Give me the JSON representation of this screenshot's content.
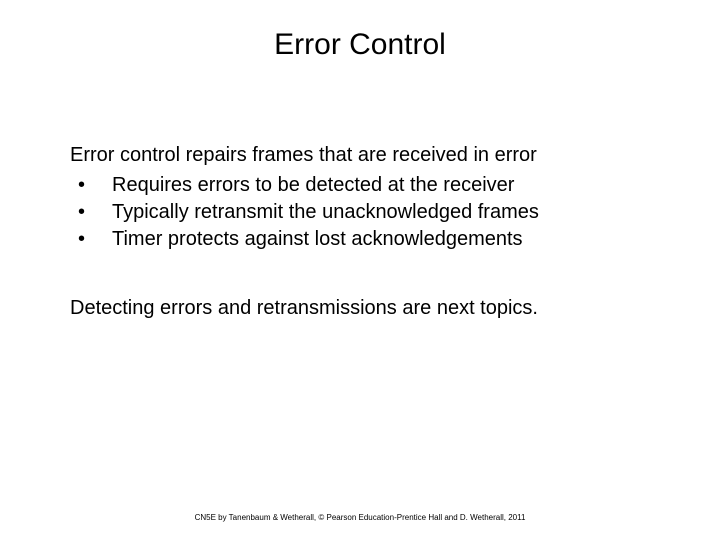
{
  "slide": {
    "title": "Error Control",
    "intro": "Error control repairs frames that are received in error",
    "bullets": [
      "Requires errors to be detected at the receiver",
      "Typically retransmit the unacknowledged frames",
      "Timer protects against lost acknowledgements"
    ],
    "conclusion": "Detecting errors and retransmissions are next topics.",
    "footer": "CN5E by Tanenbaum & Wetherall, © Pearson Education-Prentice Hall and D. Wetherall, 2011"
  }
}
